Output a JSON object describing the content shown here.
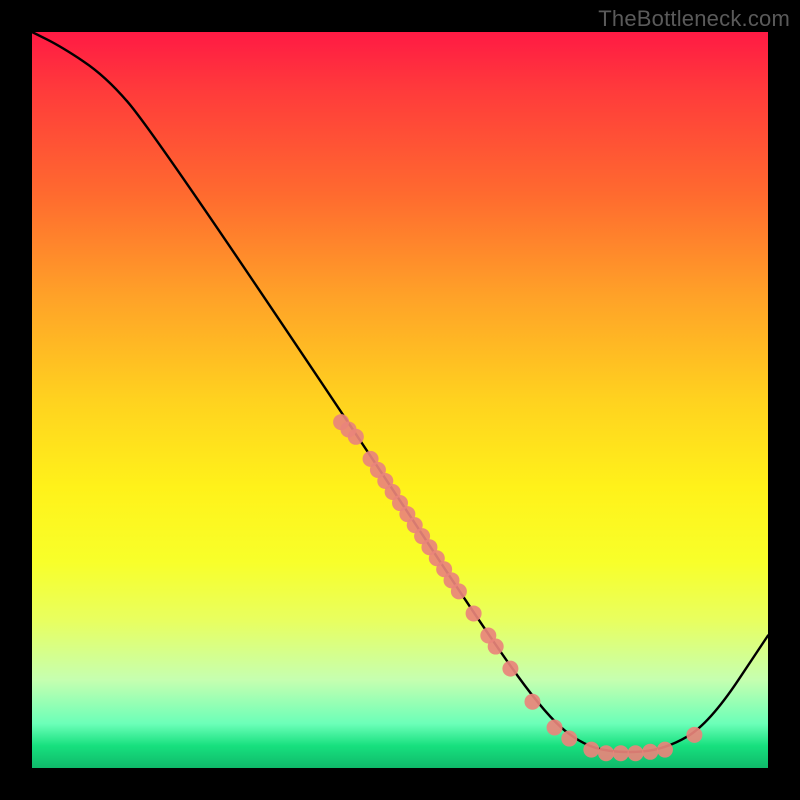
{
  "watermark": "TheBottleneck.com",
  "chart_data": {
    "type": "line",
    "title": "",
    "xlabel": "",
    "ylabel": "",
    "xlim": [
      0,
      100
    ],
    "ylim": [
      0,
      100
    ],
    "curve": [
      {
        "x": 0,
        "y": 100
      },
      {
        "x": 4,
        "y": 98
      },
      {
        "x": 10,
        "y": 94
      },
      {
        "x": 16,
        "y": 87
      },
      {
        "x": 45,
        "y": 44
      },
      {
        "x": 62,
        "y": 18
      },
      {
        "x": 70,
        "y": 7
      },
      {
        "x": 75,
        "y": 3
      },
      {
        "x": 80,
        "y": 2
      },
      {
        "x": 86,
        "y": 2.5
      },
      {
        "x": 92,
        "y": 6
      },
      {
        "x": 100,
        "y": 18
      }
    ],
    "markers": [
      {
        "x": 42,
        "y": 47
      },
      {
        "x": 43,
        "y": 46
      },
      {
        "x": 44,
        "y": 45
      },
      {
        "x": 46,
        "y": 42
      },
      {
        "x": 47,
        "y": 40.5
      },
      {
        "x": 48,
        "y": 39
      },
      {
        "x": 49,
        "y": 37.5
      },
      {
        "x": 50,
        "y": 36
      },
      {
        "x": 51,
        "y": 34.5
      },
      {
        "x": 52,
        "y": 33
      },
      {
        "x": 53,
        "y": 31.5
      },
      {
        "x": 54,
        "y": 30
      },
      {
        "x": 55,
        "y": 28.5
      },
      {
        "x": 56,
        "y": 27
      },
      {
        "x": 57,
        "y": 25.5
      },
      {
        "x": 58,
        "y": 24
      },
      {
        "x": 60,
        "y": 21
      },
      {
        "x": 62,
        "y": 18
      },
      {
        "x": 63,
        "y": 16.5
      },
      {
        "x": 65,
        "y": 13.5
      },
      {
        "x": 68,
        "y": 9
      },
      {
        "x": 71,
        "y": 5.5
      },
      {
        "x": 73,
        "y": 4
      },
      {
        "x": 76,
        "y": 2.5
      },
      {
        "x": 78,
        "y": 2
      },
      {
        "x": 80,
        "y": 2
      },
      {
        "x": 82,
        "y": 2
      },
      {
        "x": 84,
        "y": 2.2
      },
      {
        "x": 86,
        "y": 2.5
      },
      {
        "x": 90,
        "y": 4.5
      }
    ],
    "marker_color": "#e9847b",
    "line_color": "#000000"
  }
}
